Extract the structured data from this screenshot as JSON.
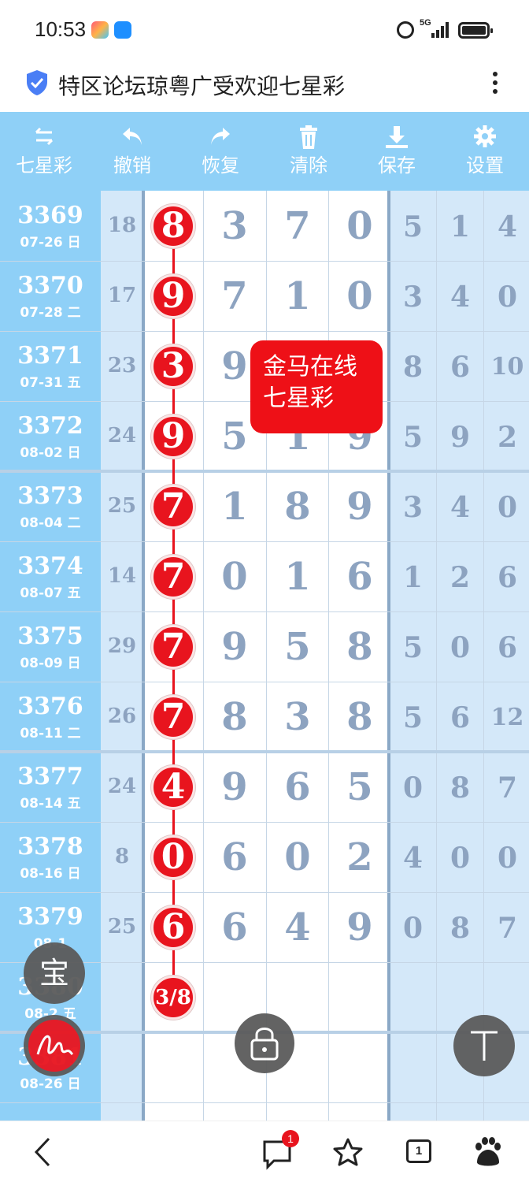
{
  "status_bar": {
    "time": "10:53",
    "network": "5G"
  },
  "header": {
    "title": "特区论坛琼粤广受欢迎七星彩"
  },
  "toolbar": {
    "items": [
      {
        "label": "七星彩",
        "icon": "swap-icon"
      },
      {
        "label": "撤销",
        "icon": "undo-icon"
      },
      {
        "label": "恢复",
        "icon": "redo-icon"
      },
      {
        "label": "清除",
        "icon": "trash-icon"
      },
      {
        "label": "保存",
        "icon": "download-icon"
      },
      {
        "label": "设置",
        "icon": "gear-icon"
      }
    ]
  },
  "rows": [
    {
      "period": "3369",
      "date": "07-26 日",
      "sum": "18",
      "first": "8",
      "mid": [
        "3",
        "7",
        "0"
      ],
      "right": [
        "5",
        "1",
        "4"
      ]
    },
    {
      "period": "3370",
      "date": "07-28 二",
      "sum": "17",
      "first": "9",
      "mid": [
        "7",
        "1",
        "0"
      ],
      "right": [
        "3",
        "4",
        "0"
      ]
    },
    {
      "period": "3371",
      "date": "07-31 五",
      "sum": "23",
      "first": "3",
      "mid": [
        "9",
        "",
        ""
      ],
      "right": [
        "8",
        "6",
        "10"
      ]
    },
    {
      "period": "3372",
      "date": "08-02 日",
      "sum": "24",
      "first": "9",
      "mid": [
        "5",
        "1",
        "9"
      ],
      "right": [
        "5",
        "9",
        "2"
      ]
    },
    {
      "period": "3373",
      "date": "08-04 二",
      "sum": "25",
      "first": "7",
      "mid": [
        "1",
        "8",
        "9"
      ],
      "right": [
        "3",
        "4",
        "0"
      ]
    },
    {
      "period": "3374",
      "date": "08-07 五",
      "sum": "14",
      "first": "7",
      "mid": [
        "0",
        "1",
        "6"
      ],
      "right": [
        "1",
        "2",
        "6"
      ]
    },
    {
      "period": "3375",
      "date": "08-09 日",
      "sum": "29",
      "first": "7",
      "mid": [
        "9",
        "5",
        "8"
      ],
      "right": [
        "5",
        "0",
        "6"
      ]
    },
    {
      "period": "3376",
      "date": "08-11 二",
      "sum": "26",
      "first": "7",
      "mid": [
        "8",
        "3",
        "8"
      ],
      "right": [
        "5",
        "6",
        "12"
      ]
    },
    {
      "period": "3377",
      "date": "08-14 五",
      "sum": "24",
      "first": "4",
      "mid": [
        "9",
        "6",
        "5"
      ],
      "right": [
        "0",
        "8",
        "7"
      ]
    },
    {
      "period": "3378",
      "date": "08-16 日",
      "sum": "8",
      "first": "0",
      "mid": [
        "6",
        "0",
        "2"
      ],
      "right": [
        "4",
        "0",
        "0"
      ]
    },
    {
      "period": "3379",
      "date": "08-1",
      "sum": "25",
      "first": "6",
      "mid": [
        "6",
        "4",
        "9"
      ],
      "right": [
        "0",
        "8",
        "7"
      ]
    },
    {
      "period": "3380",
      "date": "08-2 五",
      "sum": "",
      "first": "3/8",
      "mid": [
        "",
        "",
        ""
      ],
      "right": [
        "",
        "",
        ""
      ]
    },
    {
      "period": "3381",
      "date": "08-26 日",
      "sum": "",
      "first": "",
      "mid": [
        "",
        "",
        ""
      ],
      "right": [
        "",
        "",
        ""
      ]
    }
  ],
  "overlay": {
    "line1": "金马在线",
    "line2": "七星彩"
  },
  "fabs": {
    "bao_label": "宝"
  },
  "bottom_nav": {
    "message_badge": "1",
    "tabs_count": "1"
  },
  "colors": {
    "toolbar_bg": "#8fd0f7",
    "ball_red": "#e8141e",
    "digit_gray": "#8da3c0"
  }
}
